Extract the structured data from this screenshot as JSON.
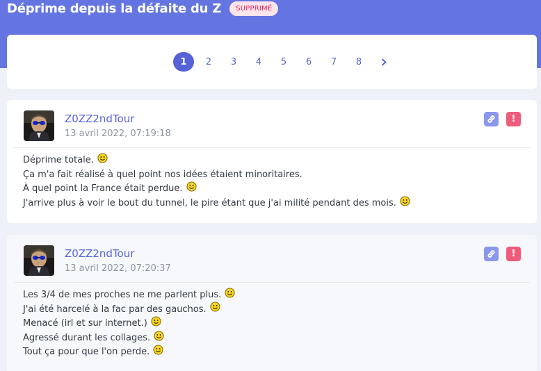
{
  "topic": {
    "title": "Déprime depuis la défaite du Z",
    "status_badge": "SUPPRIMÉ"
  },
  "pagination": {
    "pages": [
      "1",
      "2",
      "3",
      "4",
      "5",
      "6",
      "7",
      "8"
    ],
    "current_page": "1",
    "next_icon": "chevron-right-icon"
  },
  "posts": [
    {
      "author": "Z0ZZ2ndTour",
      "date": "13 avril 2022, 07:19:18",
      "lines": [
        "Déprime totale.",
        "Ça m'a fait réalisé à quel point nos idées étaient minoritaires.",
        "À quel point la France était perdue.",
        "J'arrive plus à voir le bout du tunnel, le pire étant que j'ai milité pendant des mois."
      ]
    },
    {
      "author": "Z0ZZ2ndTour",
      "date": "13 avril 2022, 07:20:37",
      "lines": [
        "Les 3/4 de mes proches ne me parlent plus.",
        "J'ai été harcelé à la fac par des gauchos.",
        "Menacé (irl et sur internet.)",
        "Agressé durant les collages.",
        "Tout ça pour que l'on perde."
      ]
    }
  ],
  "colors": {
    "banner": "#6475e2",
    "accent": "#5662d6",
    "badge_bg": "#fde4ea",
    "badge_text": "#e0245e",
    "report": "#ef5b7c",
    "link": "#8b97ea"
  },
  "icons": {
    "link": "link-icon",
    "report": "report-icon",
    "smiley": "smiley-icon"
  }
}
